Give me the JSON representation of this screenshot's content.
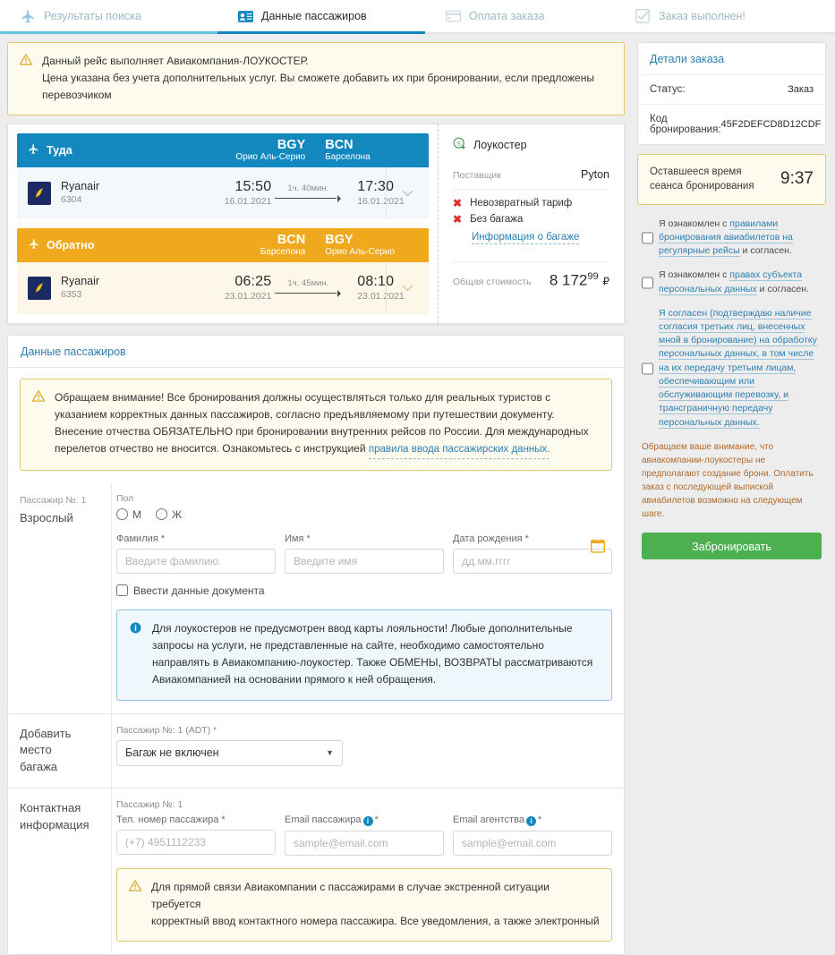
{
  "tabs": [
    {
      "label": "Результаты поиска",
      "icon": "airplane-icon",
      "state": "done"
    },
    {
      "label": "Данные пассажиров",
      "icon": "passenger-card-icon",
      "state": "active"
    },
    {
      "label": "Оплата заказа",
      "icon": "payment-card-icon",
      "state": "pending"
    },
    {
      "label": "Заказ выполнен!",
      "icon": "checkbox-done-icon",
      "state": "pending"
    }
  ],
  "top_alert": {
    "icon": "warning-triangle-icon",
    "line1": "Данный рейс выполняет Авиакомпания-ЛОУКОСТЕР.",
    "line2": "Цена указана без учета дополнительных услуг. Вы сможете добавить их при бронировании, если предложены",
    "line3": "перевозчиком"
  },
  "flight": {
    "legs": [
      {
        "direction": "Туда",
        "dir_icon": "plane-depart-icon",
        "from_code": "BGY",
        "from_city": "Орио Аль-Серио",
        "to_code": "BCN",
        "to_city": "Барселона",
        "airline": "Ryanair",
        "flight_no": "6304",
        "dep_time": "15:50",
        "dep_date": "16.01.2021",
        "duration": "1ч. 40мин.",
        "arr_time": "17:30",
        "arr_date": "16.01.2021"
      },
      {
        "direction": "Обратно",
        "dir_icon": "plane-return-icon",
        "from_code": "BCN",
        "from_city": "Барселона",
        "to_code": "BGY",
        "to_city": "Орио Аль-Серио",
        "airline": "Ryanair",
        "flight_no": "6353",
        "dep_time": "06:25",
        "dep_date": "23.01.2021",
        "duration": "1ч. 45мин.",
        "arr_time": "08:10",
        "arr_date": "23.01.2021"
      }
    ],
    "fare": {
      "lowcost_label": "Лоукостер",
      "lowcost_icon": "lowcost-coin-icon",
      "supplier_label": "Поставщик",
      "supplier_value": "Pyton",
      "feature1": "Невозвратный тариф",
      "feature2": "Без багажа",
      "baggage_link": "Информация о багаже",
      "total_label": "Общая стоимость",
      "total_main": "8 172",
      "total_cents": "99",
      "total_currency": "₽"
    }
  },
  "passengers_panel": {
    "title": "Данные пассажиров",
    "alert": {
      "icon": "warning-triangle-icon",
      "text": "Обращаем внимание! Все бронирования должны осуществляться только для реальных туристов с указанием корректных данных пассажиров, согласно предъявляемому при путешествии документу. Внесение отчества ОБЯЗАТЕЛЬНО при бронировании внутренних рейсов по России. Для международных перелетов отчество не вносится. Ознакомьтесь с инструкцией ",
      "link": "правила ввода пассажирских данных."
    },
    "passenger": {
      "number_label": "Пассажир №: 1",
      "type_label": "Взрослый",
      "gender_label": "Пол",
      "gender_male": "М",
      "gender_female": "Ж",
      "lastname_label": "Фамилия *",
      "lastname_placeholder": "Введите фамилию.",
      "lastname_value": "",
      "firstname_label": "Имя *",
      "firstname_placeholder": "Введите имя",
      "firstname_value": "",
      "birth_label": "Дата рождения *",
      "birth_placeholder": "дд.мм.гггг",
      "birth_value": "",
      "calendar_icon": "calendar-icon",
      "doc_checkbox_label": "Ввести данные документа"
    },
    "loyalty_info": {
      "icon": "info-circle-icon",
      "text": "Для лоукостеров не предусмотрен ввод карты лояльности! Любые дополнительные запросы на услуги, не представленные на сайте, необходимо самостоятельно направлять в Авиакомпанию-лоукостер. Также ОБМЕНЫ, ВОЗВРАТЫ рассматриваются Авиакомпанией на основании прямого к ней обращения."
    },
    "baggage": {
      "label_line1": "Добавить",
      "label_line2": "место",
      "label_line3": "багажа",
      "field_label": "Пассажир №: 1 (ADT) *",
      "selected": "Багаж не включен",
      "caret_icon": "chevron-down-icon"
    },
    "contacts": {
      "label_line1": "Контактная",
      "label_line2": "информация",
      "passenger_label": "Пассажир №: 1",
      "phone_label": "Тел. номер пассажира *",
      "phone_placeholder": "(+7) 4951112233",
      "phone_value": "",
      "email_pax_label": "Email пассажира",
      "email_pax_star": "*",
      "email_pax_placeholder": "sample@email.com",
      "email_pax_value": "",
      "email_agency_label": "Email агентства",
      "email_agency_star": "*",
      "email_agency_placeholder": "sample@email.com",
      "email_agency_value": "",
      "info_icon": "info-circle-icon",
      "alert": {
        "icon": "warning-triangle-icon",
        "line1": "Для прямой связи Авиакомпании с пассажирами в случае экстренной ситуации требуется",
        "line2": "корректный ввод контактного номера пассажира. Все уведомления, а также электронный"
      }
    }
  },
  "order_details": {
    "title": "Детали заказа",
    "status_label": "Статус:",
    "status_value": "Заказ",
    "booking_code_label": "Код бронирования:",
    "booking_code_value": "45F2DEFCD8D12CDF",
    "timer_label": "Оставшееся время сеанса бронирования",
    "timer_value": "9:37"
  },
  "agreements": [
    {
      "pre": "Я ознакомлен с ",
      "link": "правилами бронирования авиабилетов на регулярные рейсы",
      "post": " и согласен.",
      "checked": false
    },
    {
      "pre": "Я ознакомлен с ",
      "link": "правах субъекта персональных данных",
      "post": " и согласен.",
      "checked": false
    },
    {
      "pre": "",
      "link": "Я согласен (подтверждаю наличие согласия третьих лиц, внесенных мной в бронирование) на обработку персональных данных, в том числе на их передачу третьим лицам, обеспечивающим или обслуживающим перевозку, и трансграничную передачу персональных данных.",
      "post": "",
      "checked": false
    }
  ],
  "sidebar_note": "Обращаем ваше внимание, что авиакомпании-лоукостеры не предполагают создание брони. Оплатить заказ с последующей выпиской авиабилетов возможно на следующем шаге.",
  "book_button": "Забронировать",
  "colors": {
    "accent_blue": "#1288bf",
    "accent_orange": "#f0a91c",
    "link_blue": "#2e7fb0",
    "book_green": "#4caf50",
    "alert_border": "#e3c96b",
    "alert_bg": "#fdfbee",
    "error_red": "#e03030"
  }
}
